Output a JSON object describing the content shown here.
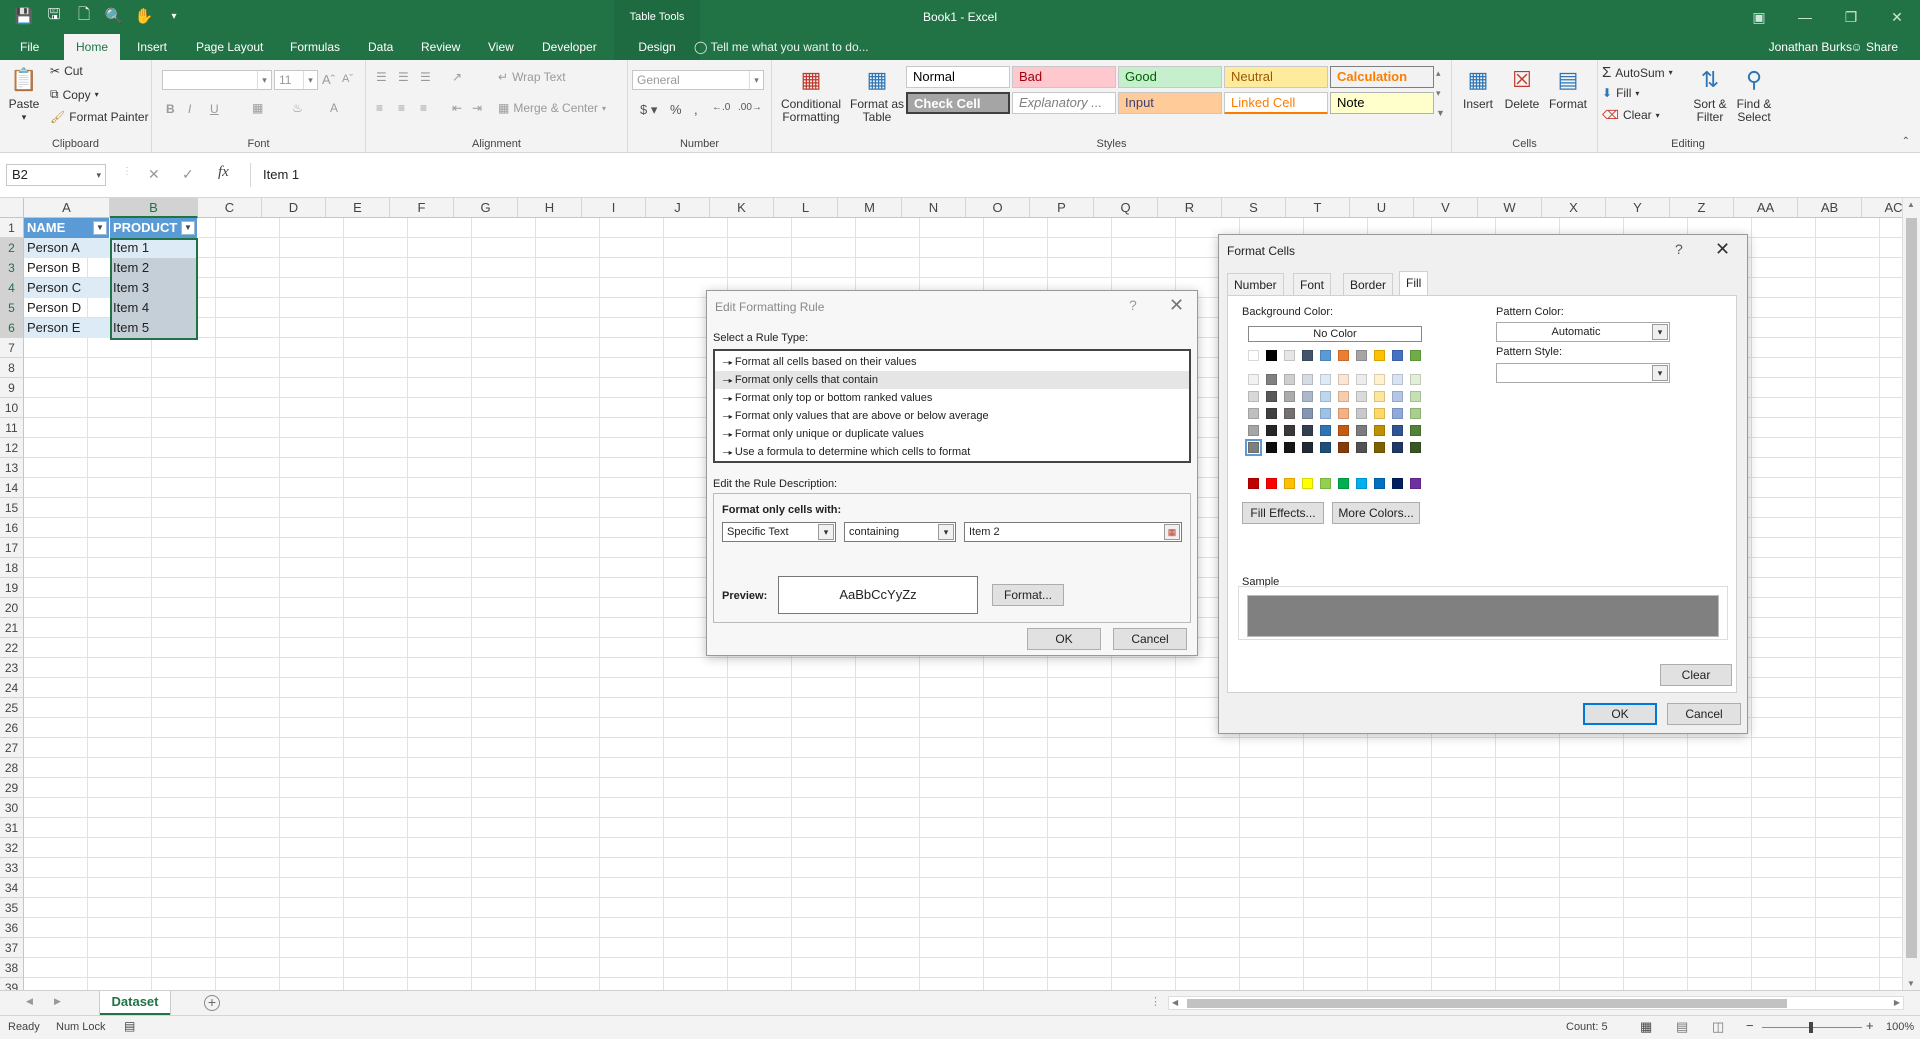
{
  "window": {
    "title": "Book1 - Excel",
    "context_tab": "Table Tools",
    "qat_icons": [
      "save-icon",
      "save-as-icon",
      "new-file-icon",
      "print-preview-icon",
      "touch-mode-icon",
      "customize-icon"
    ]
  },
  "ribbon_tabs": {
    "file": "File",
    "home": "Home",
    "insert": "Insert",
    "page_layout": "Page Layout",
    "formulas": "Formulas",
    "data": "Data",
    "review": "Review",
    "view": "View",
    "developer": "Developer",
    "design": "Design",
    "tell_me": "Tell me what you want to do...",
    "user": "Jonathan Burks",
    "share": "Share"
  },
  "ribbon": {
    "clipboard": {
      "label": "Clipboard",
      "paste": "Paste",
      "cut": "Cut",
      "copy": "Copy",
      "format_painter": "Format Painter"
    },
    "font": {
      "label": "Font",
      "font_name": "",
      "font_size": "11"
    },
    "alignment": {
      "label": "Alignment",
      "wrap_text": "Wrap Text",
      "merge_center": "Merge & Center"
    },
    "number": {
      "label": "Number",
      "format": "General"
    },
    "styles": {
      "label": "Styles",
      "conditional_formatting": "Conditional Formatting",
      "format_as_table": "Format as Table",
      "cells": [
        {
          "name": "Normal",
          "bg": "#ffffff",
          "fg": "#000000"
        },
        {
          "name": "Bad",
          "bg": "#ffc7ce",
          "fg": "#9c0006"
        },
        {
          "name": "Good",
          "bg": "#c6efce",
          "fg": "#006100"
        },
        {
          "name": "Neutral",
          "bg": "#ffeb9c",
          "fg": "#9c5700"
        },
        {
          "name": "Calculation",
          "bg": "#f2f2f2",
          "fg": "#fa7d00"
        },
        {
          "name": "Check Cell",
          "bg": "#a5a5a5",
          "fg": "#ffffff"
        },
        {
          "name": "Explanatory ...",
          "bg": "#ffffff",
          "fg": "#7f7f7f"
        },
        {
          "name": "Input",
          "bg": "#ffcc99",
          "fg": "#3f3f76"
        },
        {
          "name": "Linked Cell",
          "bg": "#ffffff",
          "fg": "#fa7d00"
        },
        {
          "name": "Note",
          "bg": "#ffffcc",
          "fg": "#000000"
        }
      ]
    },
    "cells_group": {
      "label": "Cells",
      "insert": "Insert",
      "delete": "Delete",
      "format": "Format"
    },
    "editing": {
      "label": "Editing",
      "autosum": "AutoSum",
      "fill": "Fill",
      "clear": "Clear",
      "sort_filter": "Sort & Filter",
      "find_select": "Find & Select"
    }
  },
  "formula_bar": {
    "name_box": "B2",
    "value": "Item 1"
  },
  "columns": [
    "A",
    "B",
    "C",
    "D",
    "E",
    "F",
    "G",
    "H",
    "I",
    "J",
    "K",
    "L",
    "M",
    "N",
    "O",
    "P",
    "Q",
    "R",
    "S",
    "T",
    "U",
    "V",
    "W",
    "X",
    "Y",
    "Z",
    "AA",
    "AB",
    "AC"
  ],
  "rows": [
    "1",
    "2",
    "3",
    "4",
    "5",
    "6",
    "7",
    "8",
    "9",
    "10",
    "11",
    "12",
    "13",
    "14",
    "15",
    "16",
    "17",
    "18",
    "19",
    "20",
    "21",
    "22",
    "23",
    "24",
    "25",
    "26",
    "27",
    "28",
    "29",
    "30",
    "31",
    "32",
    "33",
    "34",
    "35",
    "36",
    "37",
    "38",
    "39"
  ],
  "table": {
    "headers": [
      "NAME",
      "PRODUCT"
    ],
    "rows": [
      [
        "Person A",
        "Item 1"
      ],
      [
        "Person B",
        "Item 2"
      ],
      [
        "Person C",
        "Item 3"
      ],
      [
        "Person D",
        "Item 4"
      ],
      [
        "Person E",
        "Item 5"
      ]
    ]
  },
  "sheet": {
    "tab": "Dataset"
  },
  "status": {
    "ready": "Ready",
    "num_lock": "Num Lock",
    "count": "Count: 5",
    "zoom": "100%"
  },
  "edit_rule_dialog": {
    "title": "Edit Formatting Rule",
    "select_rule_type": "Select a Rule Type:",
    "rule_types": [
      "Format all cells based on their values",
      "Format only cells that contain",
      "Format only top or bottom ranked values",
      "Format only values that are above or below average",
      "Format only unique or duplicate values",
      "Use a formula to determine which cells to format"
    ],
    "edit_description": "Edit the Rule Description:",
    "format_only_cells_with": "Format only cells with:",
    "condition_type": "Specific Text",
    "operator": "containing",
    "value": "Item 2",
    "preview_label": "Preview:",
    "preview_text": "AaBbCcYyZz",
    "format_button": "Format...",
    "ok": "OK",
    "cancel": "Cancel"
  },
  "format_cells_dialog": {
    "title": "Format Cells",
    "tabs": [
      "Number",
      "Font",
      "Border",
      "Fill"
    ],
    "background_color": "Background Color:",
    "no_color": "No Color",
    "pattern_color": "Pattern Color:",
    "pattern_color_value": "Automatic",
    "pattern_style": "Pattern Style:",
    "fill_effects": "Fill Effects...",
    "more_colors": "More Colors...",
    "sample": "Sample",
    "sample_color": "#808080",
    "clear": "Clear",
    "ok": "OK",
    "cancel": "Cancel",
    "theme_top": [
      "#ffffff",
      "#000000",
      "#e7e6e6",
      "#44546a",
      "#5b9bd5",
      "#ed7d31",
      "#a5a5a5",
      "#ffc000",
      "#4472c4",
      "#70ad47"
    ],
    "theme_shades": [
      [
        "#f2f2f2",
        "#808080",
        "#d0cece",
        "#d6dce4",
        "#deebf6",
        "#fbe5d5",
        "#ededed",
        "#fff2cc",
        "#dae3f3",
        "#e2efd9"
      ],
      [
        "#d8d8d8",
        "#595959",
        "#aeabab",
        "#adb9ca",
        "#bdd7ee",
        "#f8cbad",
        "#dbdbdb",
        "#fee599",
        "#b4c6e7",
        "#c5e0b3"
      ],
      [
        "#bfbfbf",
        "#404040",
        "#757070",
        "#8496b0",
        "#9cc3e5",
        "#f4b183",
        "#c9c9c9",
        "#ffd965",
        "#8eaadb",
        "#a8d08d"
      ],
      [
        "#a5a5a5",
        "#262626",
        "#3a3838",
        "#323f4f",
        "#2e75b5",
        "#c55a11",
        "#7b7b7b",
        "#bf9000",
        "#2f5496",
        "#538135"
      ],
      [
        "#7f7f7f",
        "#0d0d0d",
        "#171616",
        "#222a35",
        "#1e4e79",
        "#833c0b",
        "#525252",
        "#7f6000",
        "#1f3864",
        "#375623"
      ]
    ],
    "standard": [
      "#c00000",
      "#ff0000",
      "#ffc000",
      "#ffff00",
      "#92d050",
      "#00b050",
      "#00b0f0",
      "#0070c0",
      "#002060",
      "#7030a0"
    ]
  }
}
